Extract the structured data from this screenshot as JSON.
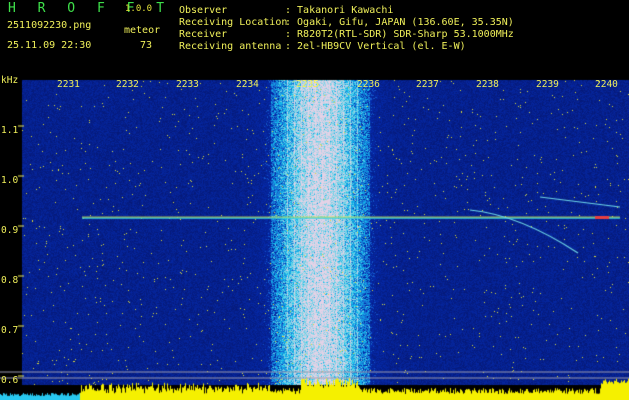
{
  "header": {
    "app_title": "H R O F F T",
    "version": "1.0.0",
    "filename": "2511092230.png",
    "datetime": "25.11.09 22:30",
    "count_label": "meteor",
    "count_value": "73",
    "observer_label": "Observer",
    "observer_value": ": Takanori Kawachi",
    "location_label": "Receiving Location",
    "location_value": ": Ogaki, Gifu, JAPAN (136.60E, 35.35N)",
    "receiver_label": "Receiver",
    "receiver_value": ": R820T2(RTL-SDR) SDR-Sharp 53.1000MHz",
    "antenna_label": "Receiving antenna",
    "antenna_value": ": 2el-HB9CV Vertical (el. E-W)"
  },
  "axes": {
    "y_unit": "kHz",
    "y_ticks": [
      "1.1",
      "1.0",
      "0.9",
      "0.8",
      "0.7",
      "0.6"
    ],
    "x_ticks": [
      "2231",
      "2232",
      "2233",
      "2234",
      "2235",
      "2236",
      "2237",
      "2238",
      "2239",
      "2240"
    ]
  },
  "colors": {
    "background": "#000000",
    "spectrum_base": "#0a1a7a",
    "signal_line": "#3ad0e0",
    "header_text": "#f0f05a",
    "title_green": "#3ee04a",
    "baseline_yellow": "#f5f000"
  }
}
